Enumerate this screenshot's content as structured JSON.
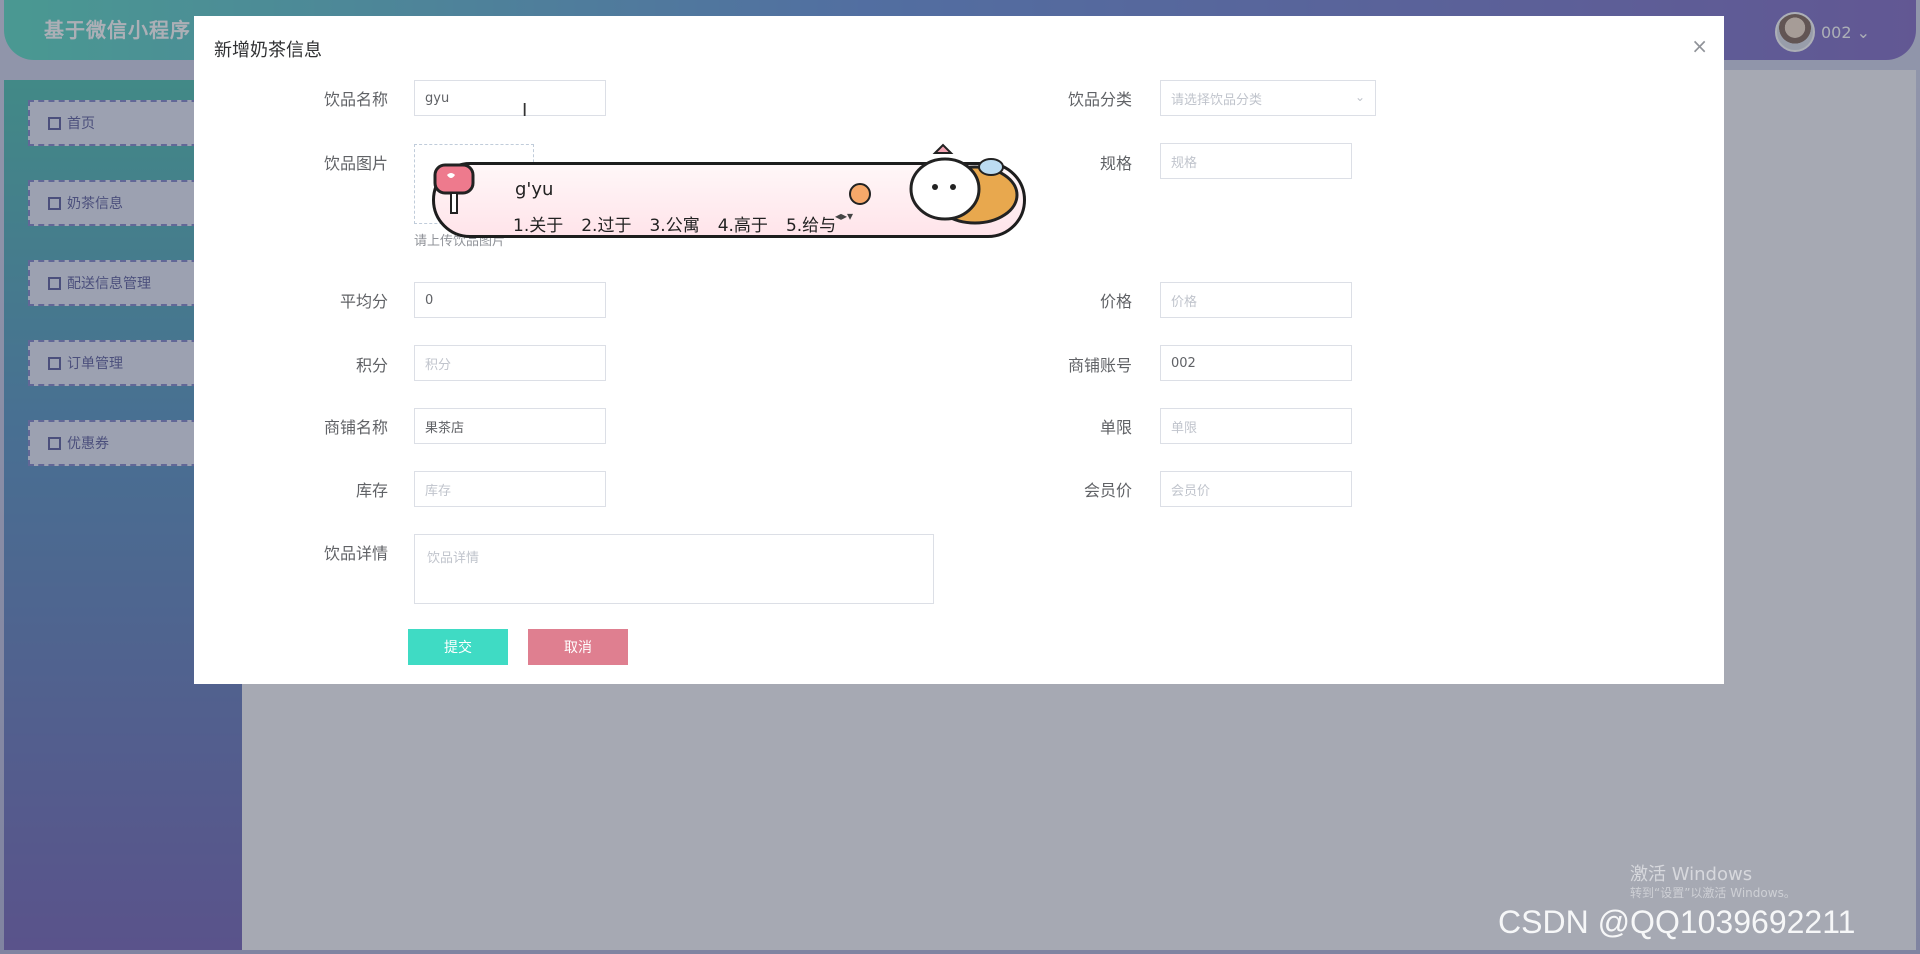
{
  "app": {
    "title": "基于微信小程序",
    "user": "002 ⌄"
  },
  "sidebar": {
    "items": [
      {
        "label": "首页"
      },
      {
        "label": "奶茶信息"
      },
      {
        "label": "配送信息管理"
      },
      {
        "label": "订单管理"
      },
      {
        "label": "优惠券"
      }
    ]
  },
  "dialog": {
    "title": "新增奶茶信息",
    "close": "×",
    "fields": {
      "name": {
        "label": "饮品名称",
        "value": "gyu"
      },
      "category": {
        "label": "饮品分类",
        "placeholder": "请选择饮品分类"
      },
      "image": {
        "label": "饮品图片",
        "tip": "请上传饮品图片"
      },
      "spec": {
        "label": "规格",
        "placeholder": "规格"
      },
      "avg_score": {
        "label": "平均分",
        "value": "0"
      },
      "price": {
        "label": "价格",
        "placeholder": "价格"
      },
      "points": {
        "label": "积分",
        "placeholder": "积分"
      },
      "shop_account": {
        "label": "商铺账号",
        "value": "002"
      },
      "shop_name": {
        "label": "商铺名称",
        "value": "果茶店"
      },
      "limit": {
        "label": "单限",
        "placeholder": "单限"
      },
      "stock": {
        "label": "库存",
        "placeholder": "库存"
      },
      "member_price": {
        "label": "会员价",
        "placeholder": "会员价"
      },
      "details": {
        "label": "饮品详情",
        "placeholder": "饮品详情"
      }
    },
    "buttons": {
      "submit": "提交",
      "cancel": "取消"
    }
  },
  "ime": {
    "pinyin": "g'yu",
    "candidates": [
      "1.关于",
      "2.过于",
      "3.公寓",
      "4.高于",
      "5.给与"
    ]
  },
  "watermarks": {
    "windows_line1": "激活 Windows",
    "windows_line2": "转到“设置”以激活 Windows。",
    "csdn": "CSDN @QQ1039692211"
  },
  "colors": {
    "submit": "#3fdbc4",
    "cancel": "#df7f90"
  }
}
